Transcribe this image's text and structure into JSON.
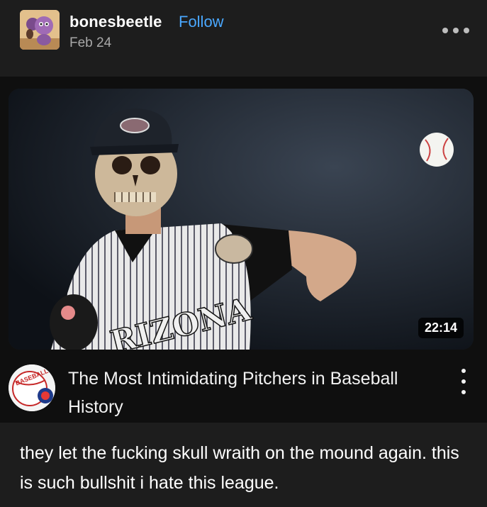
{
  "post": {
    "username": "bonesbeetle",
    "follow_label": "Follow",
    "date": "Feb 24"
  },
  "video": {
    "title": "The Most Intimidating Pitchers in Baseball History",
    "duration": "22:14",
    "jersey_text": "RIZONA",
    "channel_logo_text": "BASEBALL"
  },
  "caption": "they let the fucking skull wraith on the mound again. this is such bullshit i hate this league.",
  "colors": {
    "background": "#1d1d1d",
    "card_background": "#0f0f0f",
    "follow_link": "#4aa8ff",
    "muted_text": "#a8a8a8"
  },
  "icons": [
    "user-avatar",
    "more-options-icon",
    "video-thumbnail",
    "channel-logo",
    "video-options-icon"
  ]
}
